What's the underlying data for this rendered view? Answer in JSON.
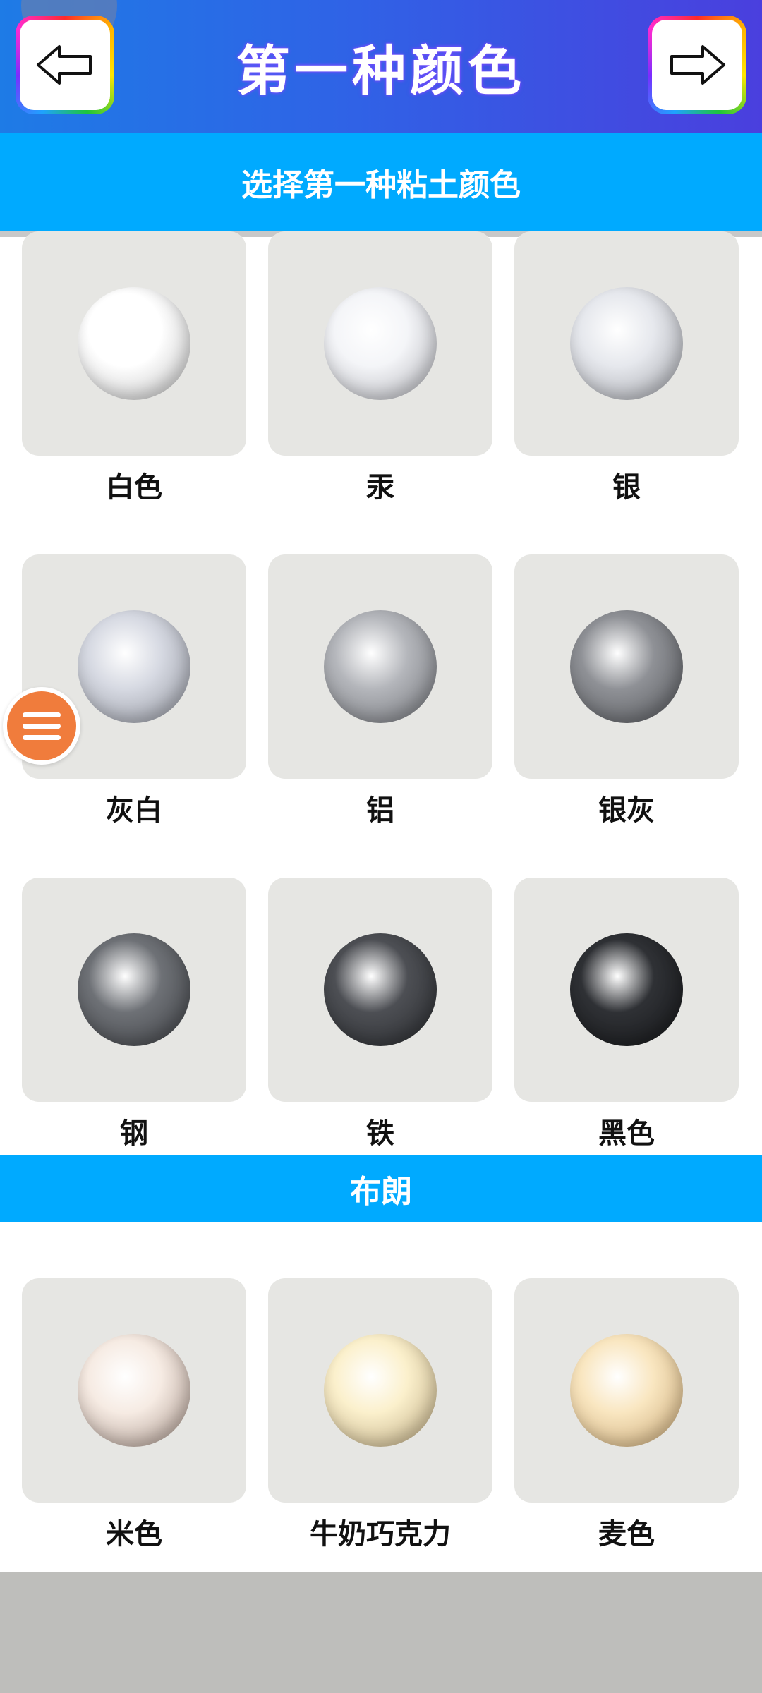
{
  "header": {
    "title": "第一种颜色"
  },
  "subheader": {
    "title": "选择第一种粘土颜色"
  },
  "section": {
    "title": "布朗"
  },
  "grey_colors": [
    {
      "label": "白色",
      "color": "#ffffff",
      "shade": "#b9b9b9"
    },
    {
      "label": "汞",
      "color": "#f4f5f8",
      "shade": "#a9aab0"
    },
    {
      "label": "银",
      "color": "#e6e8ed",
      "shade": "#9a9ca2"
    },
    {
      "label": "灰白",
      "color": "#d6d9e2",
      "shade": "#8a8d96"
    },
    {
      "label": "铝",
      "color": "#b4b6bb",
      "shade": "#6c6e73"
    },
    {
      "label": "银灰",
      "color": "#8f9196",
      "shade": "#505256"
    },
    {
      "label": "钢",
      "color": "#6e7176",
      "shade": "#3a3c40"
    },
    {
      "label": "铁",
      "color": "#4d4f54",
      "shade": "#26282b"
    },
    {
      "label": "黑色",
      "color": "#2f3135",
      "shade": "#131416"
    }
  ],
  "brown_colors": [
    {
      "label": "米色",
      "color": "#f6ebe3",
      "shade": "#a08c82"
    },
    {
      "label": "牛奶巧克力",
      "color": "#fbf0cc",
      "shade": "#b6a27a"
    },
    {
      "label": "麦色",
      "color": "#f9e6c0",
      "shade": "#c4a270"
    }
  ]
}
